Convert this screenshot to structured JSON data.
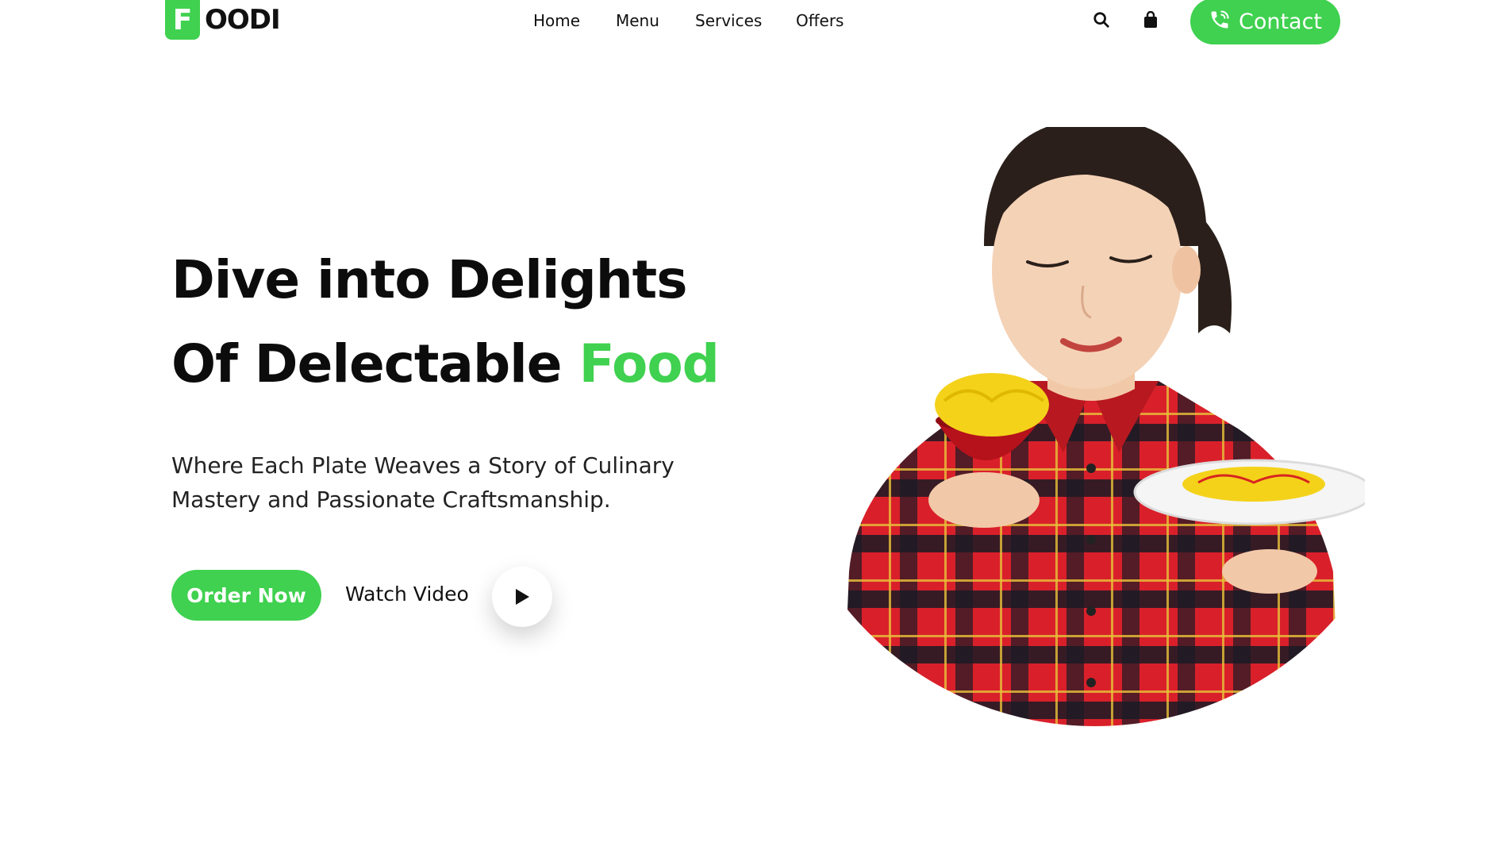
{
  "brand": {
    "logo_letter": "F",
    "logo_text": "OODI",
    "accent_color": "#3fd14f"
  },
  "nav": {
    "items": [
      {
        "label": "Home"
      },
      {
        "label": "Menu"
      },
      {
        "label": "Services"
      },
      {
        "label": "Offers"
      }
    ]
  },
  "header": {
    "search_icon": "search-icon",
    "cart_icon": "shopping-bag-icon",
    "contact_icon": "phone-icon",
    "contact_label": "Contact"
  },
  "hero": {
    "title_line1": "Dive into Delights",
    "title_line2_prefix": "Of Delectable ",
    "title_line2_highlight": "Food",
    "subtitle": "Where Each Plate Weaves a Story of Culinary Mastery and Passionate Craftsmanship.",
    "order_label": "Order Now",
    "watch_label": "Watch Video",
    "play_icon": "play-icon",
    "image_subject": "woman-with-noodles-photo"
  }
}
